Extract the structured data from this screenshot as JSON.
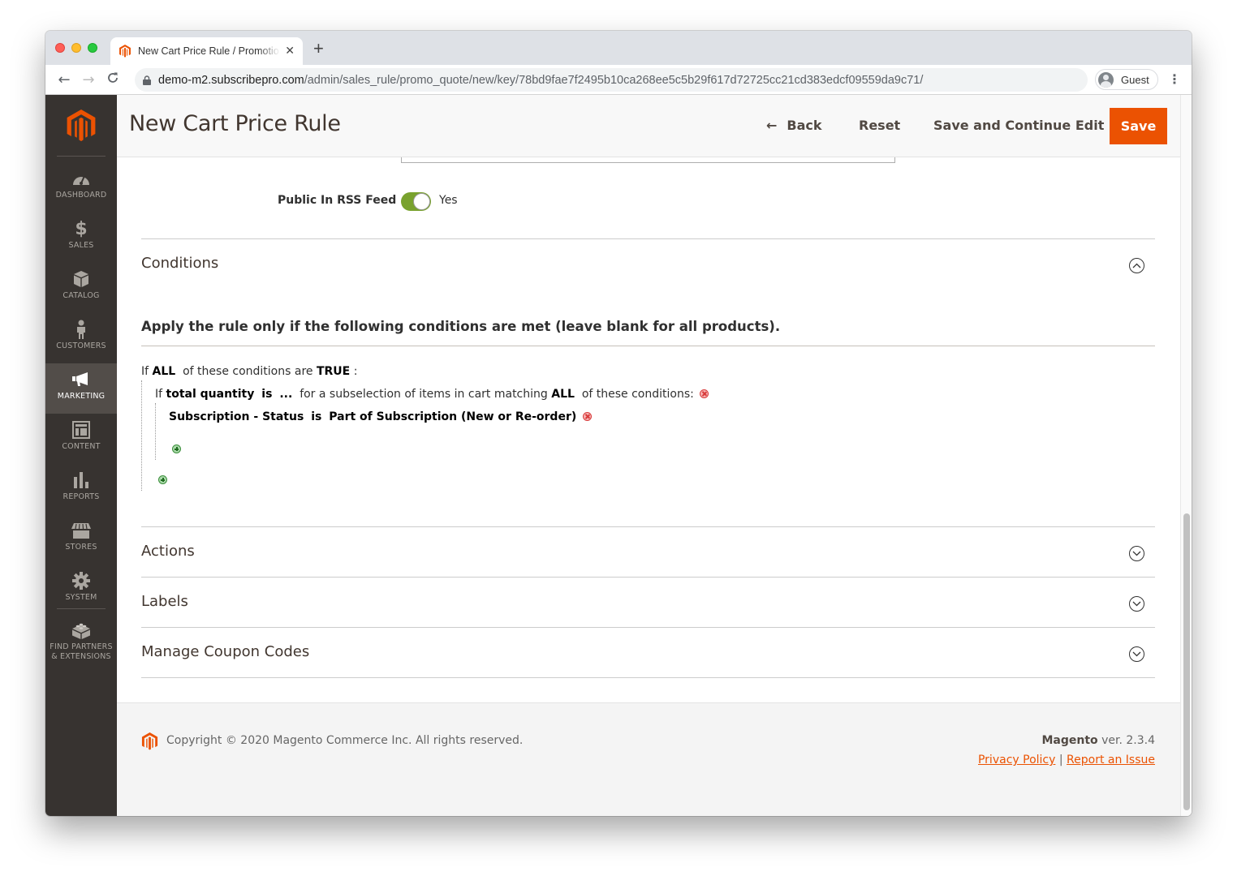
{
  "browser": {
    "tab_title": "New Cart Price Rule / Promotions / Marketing / Magento Admin",
    "new_tab_icon": "plus-icon",
    "url_host": "demo-m2.subscribepro.com",
    "url_path": "/admin/sales_rule/promo_quote/new/key/78bd9fae7f2495b10ca268ee5c5b29f617d72725cc21cd383edcf09559da9c71/",
    "profile_name": "Guest",
    "back_icon": "←",
    "forward_icon": "→",
    "reload_icon": "C",
    "menu_icon": "⋮"
  },
  "sidebar": {
    "items": [
      {
        "label": "DASHBOARD",
        "icon": "dashboard-icon"
      },
      {
        "label": "SALES",
        "icon": "dollar-icon"
      },
      {
        "label": "CATALOG",
        "icon": "box-icon"
      },
      {
        "label": "CUSTOMERS",
        "icon": "person-icon"
      },
      {
        "label": "MARKETING",
        "icon": "megaphone-icon",
        "active": true
      },
      {
        "label": "CONTENT",
        "icon": "layout-icon"
      },
      {
        "label": "REPORTS",
        "icon": "bar-chart-icon"
      },
      {
        "label": "STORES",
        "icon": "storefront-icon"
      },
      {
        "label": "SYSTEM",
        "icon": "gear-icon"
      },
      {
        "label": "FIND PARTNERS & EXTENSIONS",
        "icon": "lego-block-icon"
      }
    ]
  },
  "header": {
    "title": "New Cart Price Rule",
    "back_label": "Back",
    "reset_label": "Reset",
    "save_continue_label": "Save and Continue Edit",
    "save_label": "Save",
    "accent_color": "#eb5202"
  },
  "form": {
    "rss_label": "Public In RSS Feed",
    "rss_value": "Yes",
    "rss_enabled": true
  },
  "sections": {
    "conditions": {
      "title": "Conditions",
      "expanded": true,
      "intro": "Apply the rule only if the following conditions are met (leave blank for all products).",
      "root": {
        "prefix": "If",
        "aggregator": "ALL",
        "middle": "of these conditions are",
        "value": "TRUE",
        "suffix": ":"
      },
      "sub": {
        "prefix": "If",
        "attribute": "total quantity",
        "operator": "is",
        "value": "...",
        "middle": "for a subselection of items in cart matching",
        "aggregator": "ALL",
        "suffix": "of these conditions:"
      },
      "leaf": {
        "attribute": "Subscription - Status",
        "operator": "is",
        "value": "Part of Subscription (New or Re-order)"
      }
    },
    "actions": {
      "title": "Actions",
      "expanded": false
    },
    "labels": {
      "title": "Labels",
      "expanded": false
    },
    "coupons": {
      "title": "Manage Coupon Codes",
      "expanded": false
    }
  },
  "footer": {
    "copyright": "Copyright © 2020 Magento Commerce Inc. All rights reserved.",
    "brand": "Magento",
    "version": "ver. 2.3.4",
    "privacy_link": "Privacy Policy",
    "separator": "|",
    "report_link": "Report an Issue"
  }
}
